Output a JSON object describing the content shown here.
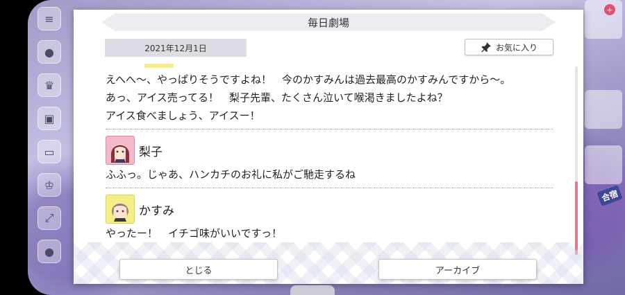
{
  "dialog": {
    "title": "毎日劇場",
    "date": "2021年12月1日",
    "favorite_label": "お気に入り",
    "favorite_icon": "pin-icon"
  },
  "messages": [
    {
      "speaker": "",
      "lines": [
        "えへへ～、やっぱりそうですよね！　今のかすみんは過去最高のかすみんですから～。",
        "あっ、アイス売ってる！　梨子先輩、たくさん泣いて喉渇きましたよね？",
        "アイス食べましょう、アイスー！"
      ]
    },
    {
      "speaker": "梨子",
      "lines": [
        "ふふっ。じゃあ、ハンカチのお礼に私がご馳走するね"
      ]
    },
    {
      "speaker": "かすみ",
      "lines": [
        "やったー！　イチゴ味がいいですっ！"
      ]
    }
  ],
  "buttons": {
    "close": "とじる",
    "archive": "アーカイブ"
  },
  "background": {
    "notification_badge": "+",
    "side_label": "合宿"
  },
  "colors": {
    "accent": "#e07990",
    "header_bg": "#ececf2",
    "date_tab_bg": "#dcdde4"
  }
}
